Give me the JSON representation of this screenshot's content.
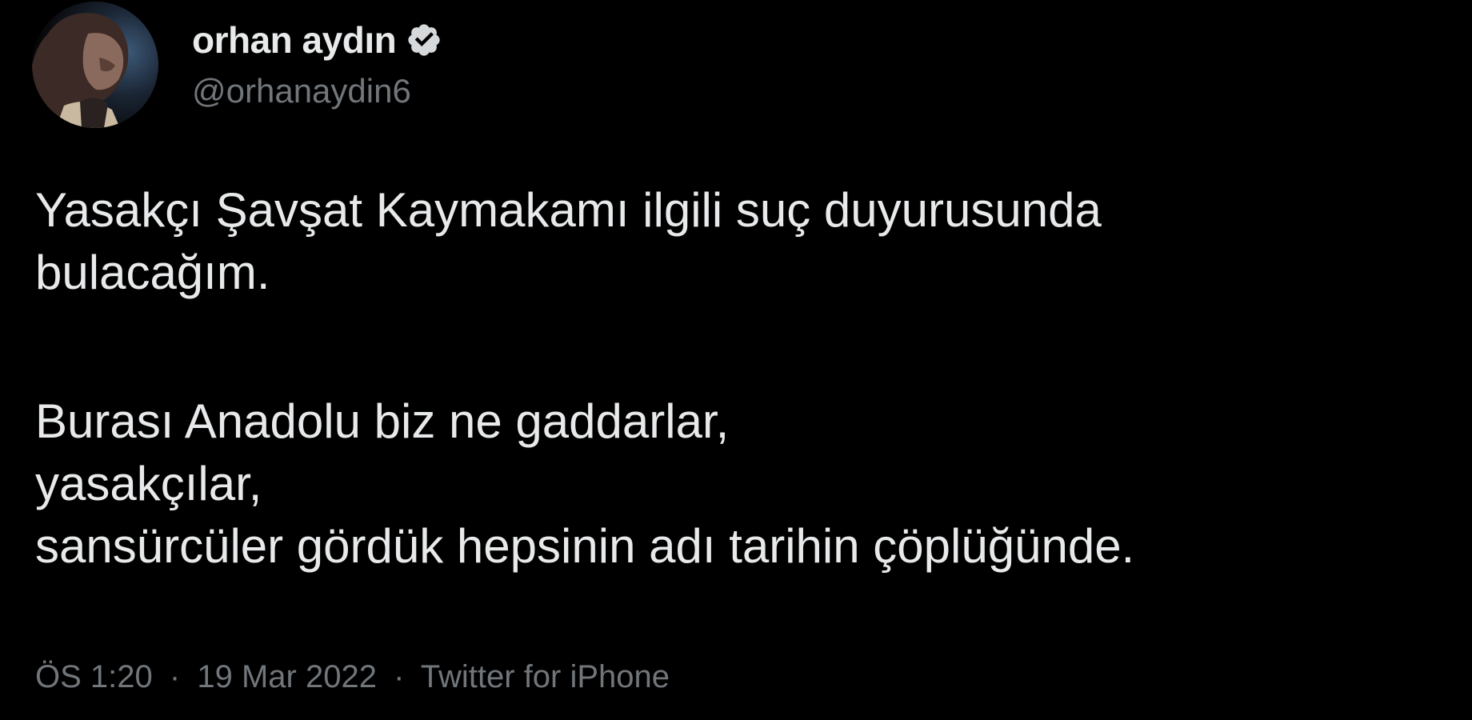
{
  "author": {
    "display_name": "orhan aydın",
    "handle": "@orhanaydin6",
    "verified": true
  },
  "tweet": {
    "lines": [
      "Yasakçı Şavşat Kaymakamı ilgili suç duyurusunda",
      "bulacağım.",
      "Burası Anadolu biz ne gaddarlar,",
      "yasakçılar,",
      "sansürcüler gördük hepsinin adı tarihin çöplüğünde."
    ]
  },
  "meta": {
    "time": "ÖS 1:20",
    "date": "19 Mar 2022",
    "separator": "·",
    "source": "Twitter for iPhone"
  },
  "icons": {
    "verified": "verified-badge-icon"
  },
  "colors": {
    "background": "#000000",
    "text": "#e7e9ea",
    "secondary": "#71767b"
  }
}
